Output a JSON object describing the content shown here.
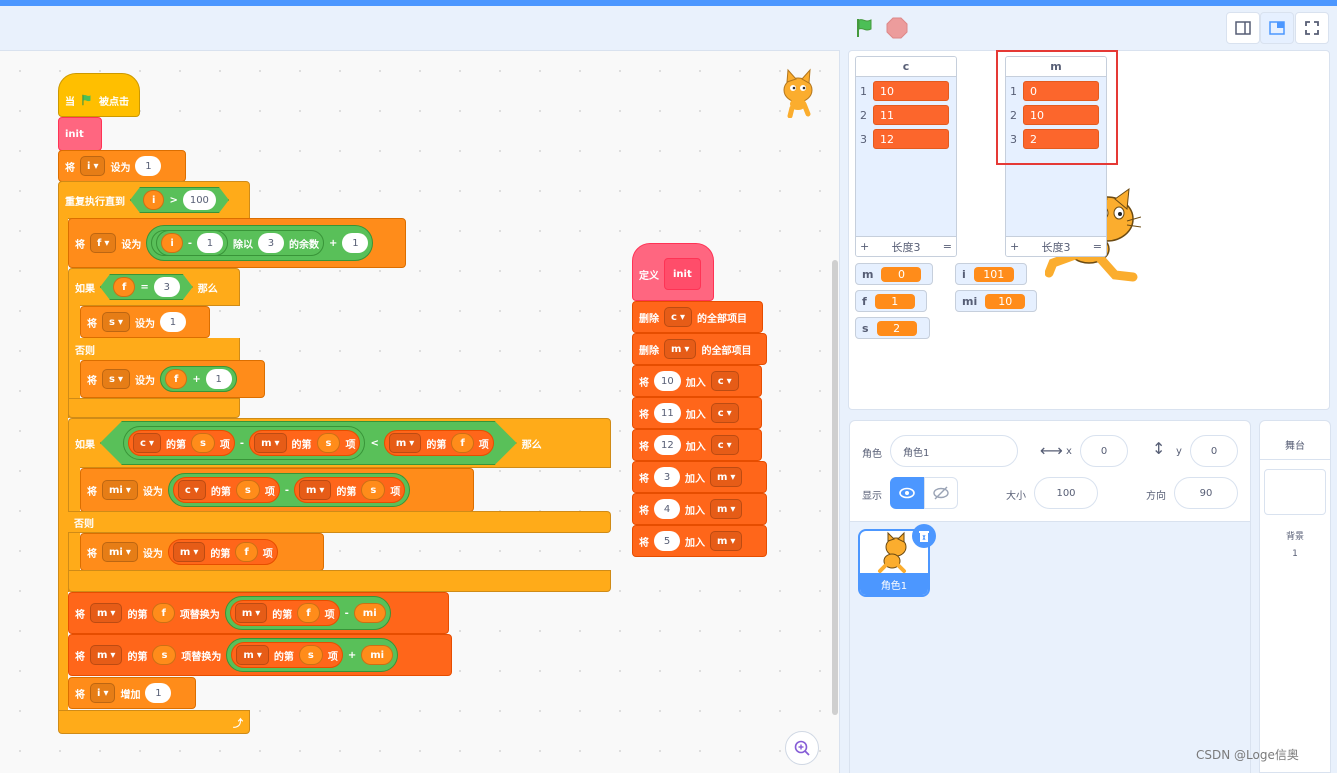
{
  "header": {
    "flag_icon": "green-flag-icon",
    "stop_icon": "stop-sign-icon",
    "layout_buttons": [
      "small-stage-icon",
      "normal-stage-icon",
      "fullscreen-icon"
    ]
  },
  "script_main": {
    "hat": {
      "when": "当",
      "flag": "green-flag-icon",
      "clicked": "被点击"
    },
    "init_call": "init",
    "set_i": {
      "op": "将",
      "var": "i",
      "to": "设为",
      "value": "1"
    },
    "repeat_until": {
      "label": "重复执行直到",
      "left": "i",
      "cmp": ">",
      "right": "100"
    },
    "set_f": {
      "op": "将",
      "var": "f",
      "to": "设为",
      "a": "i",
      "minus": "-",
      "b": "1",
      "mod": "除以",
      "c": "3",
      "rem": "的余数",
      "plus": "+",
      "d": "1"
    },
    "if1": {
      "if": "如果",
      "left": "f",
      "eq": "=",
      "right": "3",
      "then": "那么"
    },
    "set_s1": {
      "op": "将",
      "var": "s",
      "to": "设为",
      "value": "1"
    },
    "else1": "否则",
    "set_s2": {
      "op": "将",
      "var": "s",
      "to": "设为",
      "a": "f",
      "plus": "+",
      "b": "1"
    },
    "if2": {
      "if": "如果",
      "l1": "c",
      "of": "的第",
      "i1": "s",
      "item": "项",
      "minus": "-",
      "l2": "m",
      "i2": "s",
      "lt": "<",
      "l3": "m",
      "i3": "f",
      "then": "那么"
    },
    "set_mi1": {
      "op": "将",
      "var": "mi",
      "to": "设为",
      "l1": "c",
      "of": "的第",
      "i1": "s",
      "item": "项",
      "minus": "-",
      "l2": "m",
      "i2": "s"
    },
    "else2": "否则",
    "set_mi2": {
      "op": "将",
      "var": "mi",
      "to": "设为",
      "l1": "m",
      "of": "的第",
      "i1": "f",
      "item": "项"
    },
    "replace1": {
      "op": "将",
      "list": "m",
      "of": "的第",
      "idx": "f",
      "replace": "项替换为",
      "l2": "m",
      "i2": "f",
      "item": "项",
      "minus": "-",
      "val": "mi"
    },
    "replace2": {
      "op": "将",
      "list": "m",
      "of": "的第",
      "idx": "s",
      "replace": "项替换为",
      "l2": "m",
      "i2": "s",
      "item": "项",
      "plus": "+",
      "val": "mi"
    },
    "change_i": {
      "op": "将",
      "var": "i",
      "by": "增加",
      "value": "1"
    }
  },
  "script_def": {
    "define": "定义",
    "name": "init",
    "delete_c": {
      "op": "删除",
      "list": "c",
      "all": "的全部项目"
    },
    "delete_m": {
      "op": "删除",
      "list": "m",
      "all": "的全部项目"
    },
    "adds": [
      {
        "op": "将",
        "value": "10",
        "add": "加入",
        "list": "c"
      },
      {
        "op": "将",
        "value": "11",
        "add": "加入",
        "list": "c"
      },
      {
        "op": "将",
        "value": "12",
        "add": "加入",
        "list": "c"
      },
      {
        "op": "将",
        "value": "3",
        "add": "加入",
        "list": "m"
      },
      {
        "op": "将",
        "value": "4",
        "add": "加入",
        "list": "m"
      },
      {
        "op": "将",
        "value": "5",
        "add": "加入",
        "list": "m"
      }
    ]
  },
  "stage": {
    "list_c": {
      "title": "c",
      "items": [
        {
          "idx": "1",
          "val": "10"
        },
        {
          "idx": "2",
          "val": "11"
        },
        {
          "idx": "3",
          "val": "12"
        }
      ],
      "add": "+",
      "length": "长度3",
      "resize": "="
    },
    "list_m": {
      "title": "m",
      "items": [
        {
          "idx": "1",
          "val": "0"
        },
        {
          "idx": "2",
          "val": "10"
        },
        {
          "idx": "3",
          "val": "2"
        }
      ],
      "add": "+",
      "length": "长度3",
      "resize": "="
    },
    "vars": {
      "m": {
        "name": "m",
        "value": "0"
      },
      "f": {
        "name": "f",
        "value": "1"
      },
      "s": {
        "name": "s",
        "value": "2"
      },
      "i": {
        "name": "i",
        "value": "101"
      },
      "mi": {
        "name": "mi",
        "value": "10"
      }
    }
  },
  "sprite_info": {
    "sprite_label": "角色",
    "sprite_name": "角色1",
    "x_label": "x",
    "x_value": "0",
    "y_label": "y",
    "y_value": "0",
    "show_label": "显示",
    "size_label": "大小",
    "size_value": "100",
    "direction_label": "方向",
    "direction_value": "90",
    "thumb_label": "角色1"
  },
  "stage_panel": {
    "title": "舞台",
    "backdrop_label": "背景",
    "backdrop_count": "1"
  },
  "watermark": "CSDN @Loge信奥",
  "colors": {
    "events": "#ffbf00",
    "control": "#ffab19",
    "variables": "#ff8c1a",
    "lists": "#ff661a",
    "operators": "#59c059",
    "myblocks": "#ff6680",
    "highlight": "#e53935"
  }
}
